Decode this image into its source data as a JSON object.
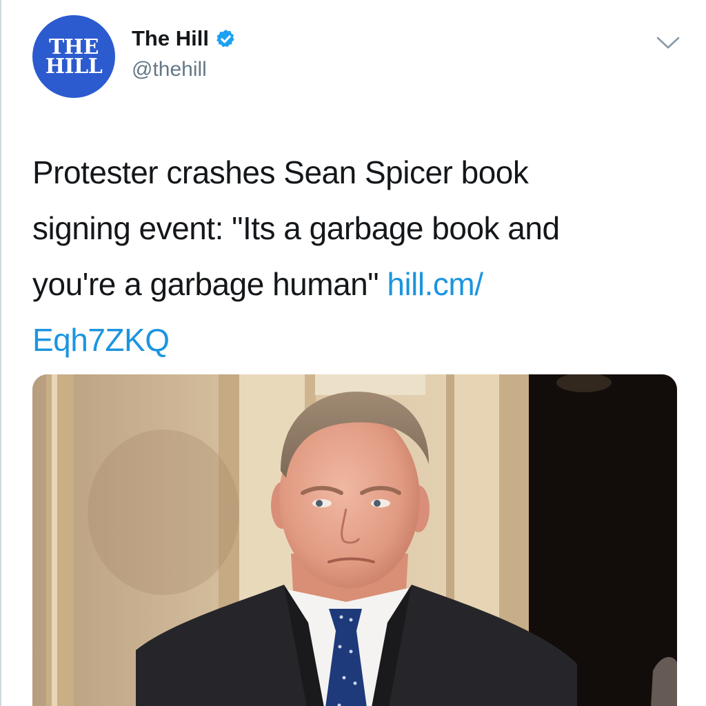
{
  "account": {
    "avatar_text": "THE\nHILL",
    "display_name": "The Hill",
    "handle": "@thehill",
    "verified": true
  },
  "tweet": {
    "text_lines": [
      "Protester crashes Sean Spicer book",
      "signing event: \"Its a garbage book and",
      "you're a garbage human\" "
    ],
    "link_part1": "hill.cm/",
    "link_part2": "Eqh7ZKQ"
  },
  "icons": {
    "verified": "verified-badge-icon",
    "menu": "chevron-down-icon"
  },
  "colors": {
    "avatar_bg": "#2c5bcf",
    "link": "#1b95e0",
    "verified": "#1da1f2",
    "text": "#14171a",
    "secondary": "#657786"
  }
}
